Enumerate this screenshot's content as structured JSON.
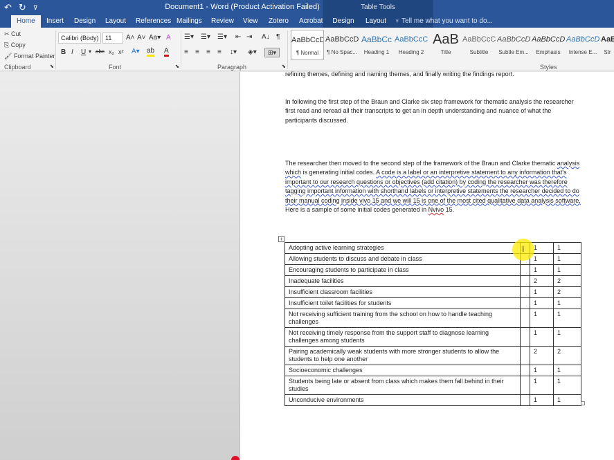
{
  "title_bar": {
    "document_title": "Document1 - Word (Product Activation Failed)",
    "context_group": "Table Tools",
    "qat_icons": [
      "undo-icon",
      "redo-icon",
      "customize-icon"
    ]
  },
  "tabs": [
    {
      "label": "Home",
      "active": true
    },
    {
      "label": "Insert"
    },
    {
      "label": "Design"
    },
    {
      "label": "Layout"
    },
    {
      "label": "References"
    },
    {
      "label": "Mailings"
    },
    {
      "label": "Review"
    },
    {
      "label": "View"
    },
    {
      "label": "Zotero"
    },
    {
      "label": "Acrobat"
    },
    {
      "label": "Design",
      "contextual": true
    },
    {
      "label": "Layout",
      "contextual": true
    }
  ],
  "tell_me": "Tell me what you want to do...",
  "clipboard": {
    "cut": "Cut",
    "copy": "Copy",
    "format_painter": "Format Painter",
    "group_label": "Clipboard"
  },
  "font": {
    "family": "Calibri (Body)",
    "size": "11",
    "group_label": "Font",
    "change_case": "Aa"
  },
  "paragraph": {
    "group_label": "Paragraph"
  },
  "styles": {
    "group_label": "Styles",
    "items": [
      {
        "preview": "AaBbCcDc",
        "label": "¶ Normal",
        "selected": true
      },
      {
        "preview": "AaBbCcDc",
        "label": "¶ No Spac..."
      },
      {
        "preview": "AaBbCc",
        "label": "Heading 1"
      },
      {
        "preview": "AaBbCcC",
        "label": "Heading 2"
      },
      {
        "preview": "AaB",
        "label": "Title"
      },
      {
        "preview": "AaBbCcC",
        "label": "Subtitle"
      },
      {
        "preview": "AaBbCcDc",
        "label": "Subtle Em..."
      },
      {
        "preview": "AaBbCcDc",
        "label": "Emphasis"
      },
      {
        "preview": "AaBbCcDc",
        "label": "Intense E..."
      },
      {
        "preview": "AaBb",
        "label": "Str"
      }
    ]
  },
  "document": {
    "para1": "refining themes, defining and naming themes, and finally writing the findings report.",
    "para2": "In following the first step of the Braun and Clarke six step framework for thematic analysis the researcher first read and reread all their transcripts to get an in depth understanding and nuance of what the participants discussed.",
    "para3_a": "The researcher then moved to the second step of the framework of the Braun and Clarke thematic ",
    "para3_b": "analysis which",
    "para3_c": " is generating initial codes. ",
    "para3_d": "A code is a label or an interpretive statement to any information that's important to our research questions or objectives (add citation) by coding the researcher was therefore tagging important information with shorthand labels or interpretive statements the researcher decided to do their manual coding inside vivo 15 and we will 15 is one of the most cited qualitative data analysis software.",
    "para3_e": " Here is a sample of some initial codes generated in ",
    "para3_f": "Nvivo",
    "para3_g": " 15.",
    "table_rows": [
      {
        "code": "Adopting  active learning strategies",
        "a": "1",
        "b": "1"
      },
      {
        "code": "Allowing students to discuss and debate in class",
        "a": "1",
        "b": "1"
      },
      {
        "code": "Encouraging students to participate in class",
        "a": "1",
        "b": "1"
      },
      {
        "code": "Inadequate facilities",
        "a": "2",
        "b": "2"
      },
      {
        "code": "Insufficient classroom facilities",
        "a": "1",
        "b": "2"
      },
      {
        "code": "Insufficient toilet facilities for students",
        "a": "1",
        "b": "1"
      },
      {
        "code": "Not receiving sufficient training from the school on how to handle teaching challenges",
        "a": "1",
        "b": "1"
      },
      {
        "code": "Not receiving timely response from the support staff to diagnose learning challenges among students",
        "a": "1",
        "b": "1"
      },
      {
        "code": "Pairing academically weak students with more stronger students to allow the students to help one another",
        "a": "2",
        "b": "2"
      },
      {
        "code": "Socioeconomic challenges",
        "a": "1",
        "b": "1"
      },
      {
        "code": "Students being late or absent from class which makes them fall behind in their studies",
        "a": "1",
        "b": "1"
      },
      {
        "code": "Unconducive environments",
        "a": "1",
        "b": "1"
      }
    ]
  }
}
